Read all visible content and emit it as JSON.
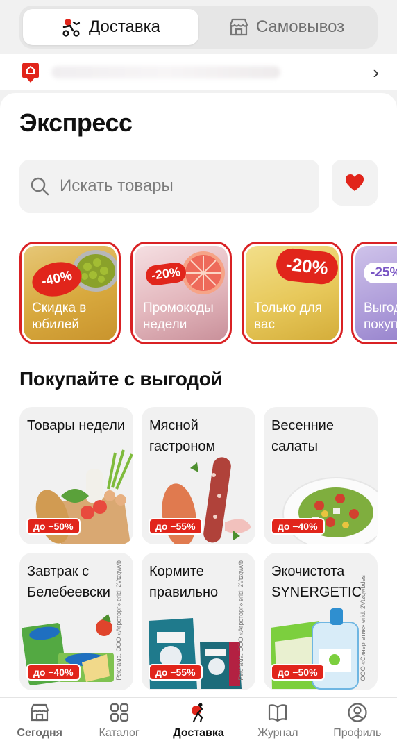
{
  "colors": {
    "accent": "#e1251b",
    "background": "#f1f1f1"
  },
  "delivery_toggle": {
    "delivery": {
      "label": "Доставка",
      "icon": "courier-icon"
    },
    "pickup": {
      "label": "Самовывоз",
      "icon": "store-icon"
    }
  },
  "address": {
    "icon": "home-pin-icon",
    "chevron": "›"
  },
  "page": {
    "title": "Экспресс"
  },
  "search": {
    "placeholder": "Искать товары",
    "icon": "search-icon",
    "favorites_icon": "heart-icon"
  },
  "stories": [
    {
      "label": "Скидка в юбилей",
      "badge": "-40%"
    },
    {
      "label": "Промокоды недели",
      "badge": "-20%"
    },
    {
      "label": "Только для вас",
      "badge": "-20%"
    },
    {
      "label": "Выгодные покупки",
      "badge": "-25%"
    }
  ],
  "section": {
    "title": "Покупайте с выгодой"
  },
  "cards": [
    {
      "title": "Товары недели",
      "badge": "до −50%"
    },
    {
      "title": "Мясной гастроном",
      "badge": "до −55%"
    },
    {
      "title": "Весенние салаты",
      "badge": "до −40%"
    },
    {
      "title": "Завтрак с Белебеевски",
      "badge": "до −40%",
      "fine": "Реклама. ООО «Агроторг» erid: 2Vtzqwvb"
    },
    {
      "title": "Кормите правильно",
      "badge": "до −55%",
      "fine": "Реклама. ООО «Агроторг» erid: 2Vtzqwvb"
    },
    {
      "title": "Экочистота SYNERGETIC",
      "badge": "до −50%",
      "fine": "ООО «Синергетик» erid: 2Vtzqwbdes"
    }
  ],
  "nav": [
    {
      "label": "Сегодня",
      "icon": "store-icon"
    },
    {
      "label": "Каталог",
      "icon": "grid-icon"
    },
    {
      "label": "Доставка",
      "icon": "courier-icon"
    },
    {
      "label": "Журнал",
      "icon": "book-icon"
    },
    {
      "label": "Профиль",
      "icon": "profile-icon"
    }
  ]
}
